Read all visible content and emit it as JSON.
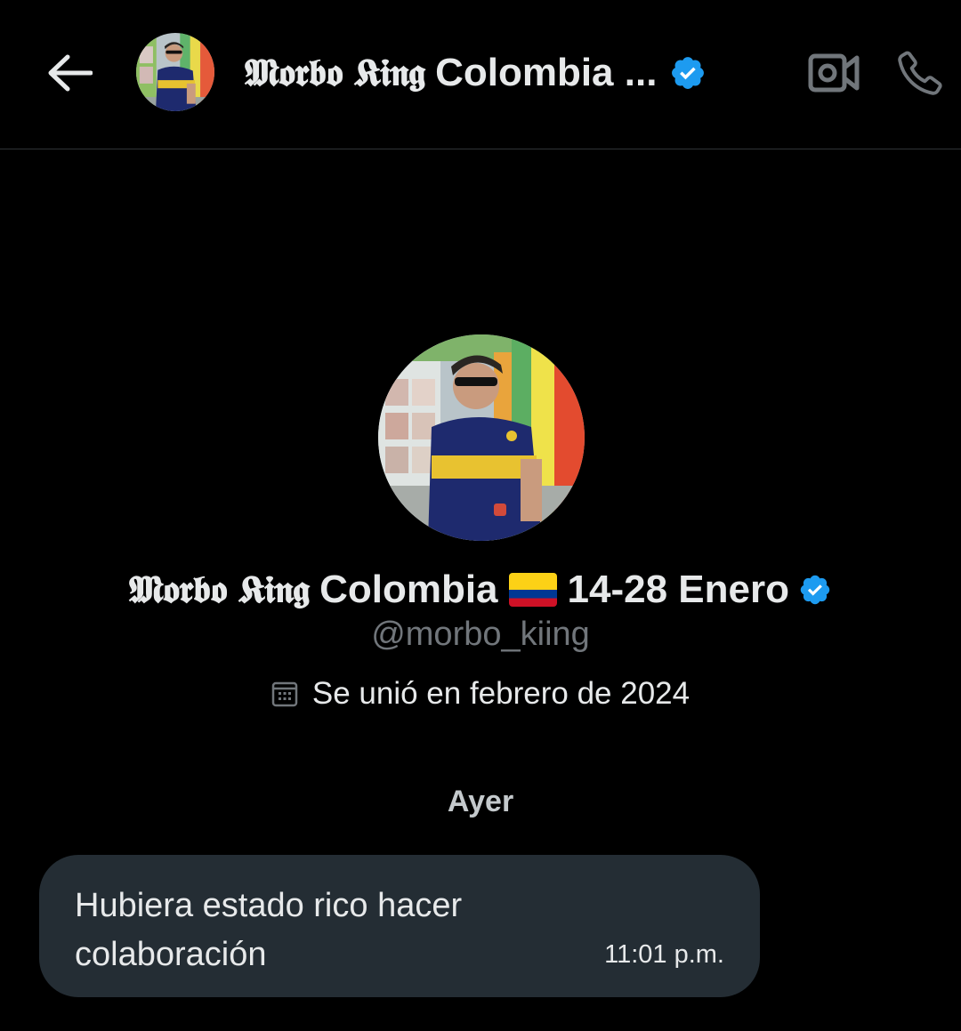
{
  "header": {
    "name_gothic": "𝕸𝖔𝖗𝖇𝖔 𝕶𝖎𝖓𝖌",
    "name_rest": "Colombia ...",
    "back_icon": "arrow-left-icon",
    "video_icon": "video-camera-icon",
    "call_icon": "phone-icon",
    "verified_icon": "verified-badge-icon"
  },
  "profile": {
    "name_gothic": "𝕸𝖔𝖗𝖇𝖔 𝕶𝖎𝖓𝖌",
    "name_rest": "Colombia",
    "flag": "colombia-flag-icon",
    "dates": "14-28 Enero",
    "handle": "@morbo_kiing",
    "joined": "Se unió en febrero de 2024",
    "calendar_icon": "calendar-icon"
  },
  "chat": {
    "day_label": "Ayer",
    "messages": [
      {
        "text": "Hubiera estado rico hacer colaboración",
        "time": "11:01 p.m."
      }
    ]
  },
  "colors": {
    "background": "#000000",
    "bubble": "#242d34",
    "verified": "#1d9bf0",
    "muted": "#71767b"
  }
}
